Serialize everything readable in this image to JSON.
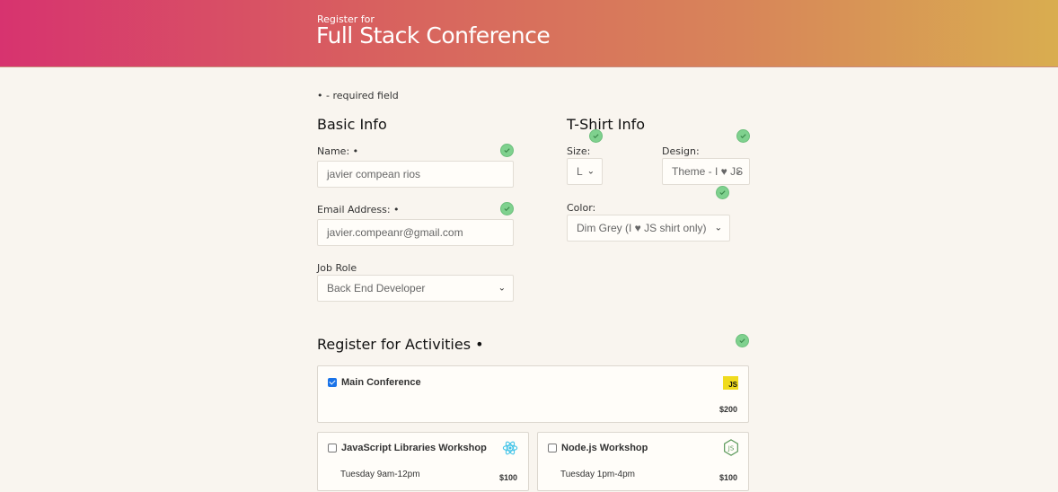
{
  "header": {
    "subtitle": "Register for",
    "title": "Full Stack Conference",
    "gradient_start": "#d7336f",
    "gradient_end": "#d9ad50"
  },
  "required_note": "• - required field",
  "basic_info": {
    "heading": "Basic Info",
    "name_label": "Name: •",
    "name_value": "javier compean rios",
    "email_label": "Email Address: •",
    "email_value": "javier.compeanr@gmail.com",
    "job_role_label": "Job Role",
    "job_role_value": "Back End Developer"
  },
  "tshirt_info": {
    "heading": "T-Shirt Info",
    "size_label": "Size:",
    "size_value": "L",
    "design_label": "Design:",
    "design_value": "Theme - I ♥ JS",
    "color_label": "Color:",
    "color_value": "Dim Grey (I ♥ JS shirt only)"
  },
  "activities": {
    "heading": "Register for Activities •",
    "items": [
      {
        "name": "Main Conference",
        "time": "",
        "price": "$200",
        "checked": true,
        "icon": "javascript-icon"
      },
      {
        "name": "JavaScript Libraries Workshop",
        "time": "Tuesday 9am-12pm",
        "price": "$100",
        "checked": false,
        "icon": "react-icon"
      },
      {
        "name": "Node.js Workshop",
        "time": "Tuesday 1pm-4pm",
        "price": "$100",
        "checked": false,
        "icon": "nodejs-icon"
      }
    ]
  },
  "icons": {
    "valid": "valid-check-icon",
    "chevron": "chevron-down-icon",
    "js_badge_text": "JS"
  },
  "colors": {
    "valid_green": "#7fd18e",
    "checkbox_blue": "#1a73e8",
    "js_yellow": "#f0db1e",
    "react_cyan": "#3fc3e8",
    "node_green": "#5c9a5b"
  }
}
